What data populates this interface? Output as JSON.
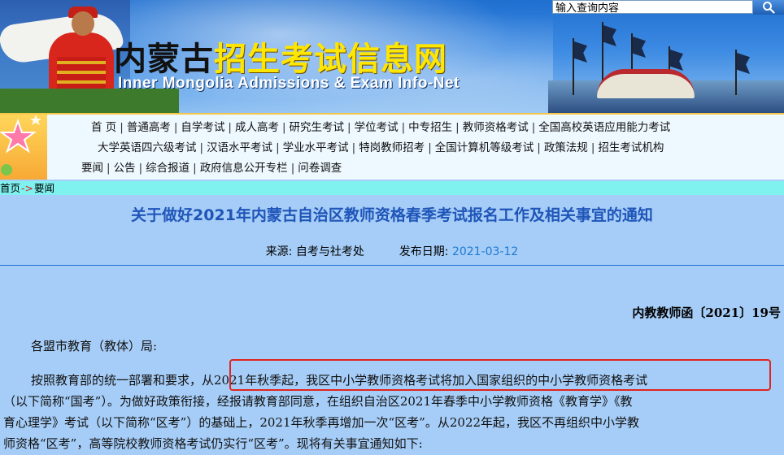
{
  "search": {
    "placeholder": "输入查询内容",
    "value": "输入查询内容"
  },
  "banner": {
    "title_part1": "内蒙古",
    "title_part2": "招生考试信息网",
    "title_en": "Inner Mongolia Admissions &  Exam Info-Net"
  },
  "nav": {
    "row1": [
      "首 页",
      "普通高考",
      "自学考试",
      "成人高考",
      "研究生考试",
      "学位考试",
      "中专招生",
      "教师资格考试",
      "全国高校英语应用能力考试"
    ],
    "row2": [
      "大学英语四六级考试",
      "汉语水平考试",
      "学业水平考试",
      "特岗教师招考",
      "全国计算机等级考试",
      "政策法规",
      "招生考试机构"
    ],
    "row3": [
      "要闻",
      "公告",
      "综合报道",
      "政府信息公开专栏",
      "问卷调查"
    ]
  },
  "breadcrumb": {
    "home": "首页",
    "arrow": "->",
    "current": "要闻"
  },
  "article": {
    "title": "关于做好2021年内蒙古自治区教师资格春季考试报名工作及相关事宜的通知",
    "source_label": "来源:",
    "source": "自考与社考处",
    "date_label": "发布日期:",
    "date": "2021-03-12",
    "doc_number": "内教教师函〔2021〕19号",
    "salutation": "各盟市教育（教体）局:",
    "p1_line1": "按照教育部的统一部署和要求，从2021年秋季起，我区中小学教师资格考试将加入国家组织的中小学教师资格考试",
    "p1_line2": "（以下简称“国考”）。为做好政策衔接，经报请教育部同意，在组织自治区2021年春季中小学教师资格《教育学》《教",
    "p1_line3": "育心理学》考试（以下简称“区考”）的基础上，2021年秋季再增加一次“区考”。从2022年起，我区不再组织中小学教",
    "p1_line4": "师资格“区考”，高等院校教师资格考试仍实行“区考”。现将有关事宜通知如下:"
  },
  "colors": {
    "title_blue": "#1f55b8",
    "date_blue": "#1f7ad1",
    "highlight_red": "#e0251e",
    "page_bg": "#a6cdf7",
    "crumb_bg": "#7ff2f0"
  }
}
